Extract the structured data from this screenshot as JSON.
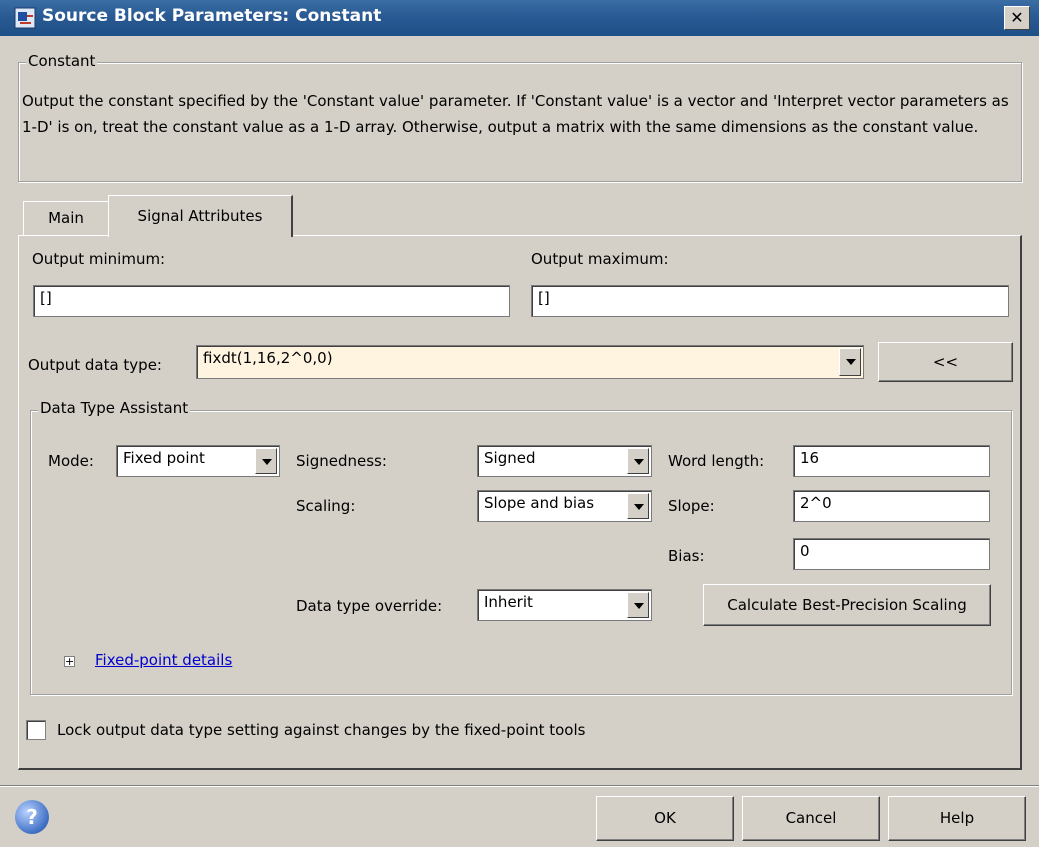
{
  "window": {
    "title": "Source Block Parameters: Constant",
    "close_label": "✕",
    "icon": "simulink-block-icon"
  },
  "description_group": {
    "legend": "Constant",
    "text": "Output the constant specified by the 'Constant value' parameter. If 'Constant value' is a vector and 'Interpret vector parameters as 1-D' is on, treat the constant value as a 1-D array. Otherwise, output a matrix with the same dimensions as the constant value."
  },
  "tabs": [
    {
      "label": "Main",
      "active": false
    },
    {
      "label": "Signal Attributes",
      "active": true
    }
  ],
  "signal_attributes": {
    "output_minimum_label": "Output minimum:",
    "output_minimum_value": "[]",
    "output_maximum_label": "Output maximum:",
    "output_maximum_value": "[]",
    "output_data_type_label": "Output data type:",
    "output_data_type_value": "fixdt(1,16,2^0,0)",
    "assistant_toggle_label": "<<"
  },
  "assistant": {
    "legend": "Data Type Assistant",
    "mode_label": "Mode:",
    "mode_value": "Fixed point",
    "signedness_label": "Signedness:",
    "signedness_value": "Signed",
    "word_length_label": "Word length:",
    "word_length_value": "16",
    "scaling_label": "Scaling:",
    "scaling_value": "Slope and bias",
    "slope_label": "Slope:",
    "slope_value": "2^0",
    "bias_label": "Bias:",
    "bias_value": "0",
    "override_label": "Data type override:",
    "override_value": "Inherit",
    "calc_button": "Calculate Best-Precision Scaling",
    "details_link": "Fixed-point details"
  },
  "lock": {
    "label": "Lock output data type setting against changes by the fixed-point tools",
    "checked": false
  },
  "footer": {
    "ok": "OK",
    "cancel": "Cancel",
    "help": "Help"
  },
  "colors": {
    "titlebar": "#2a5a93",
    "dialog_bg": "#d4d0c8",
    "data_type_field_bg": "#fff4e0",
    "link": "#0000cc"
  }
}
